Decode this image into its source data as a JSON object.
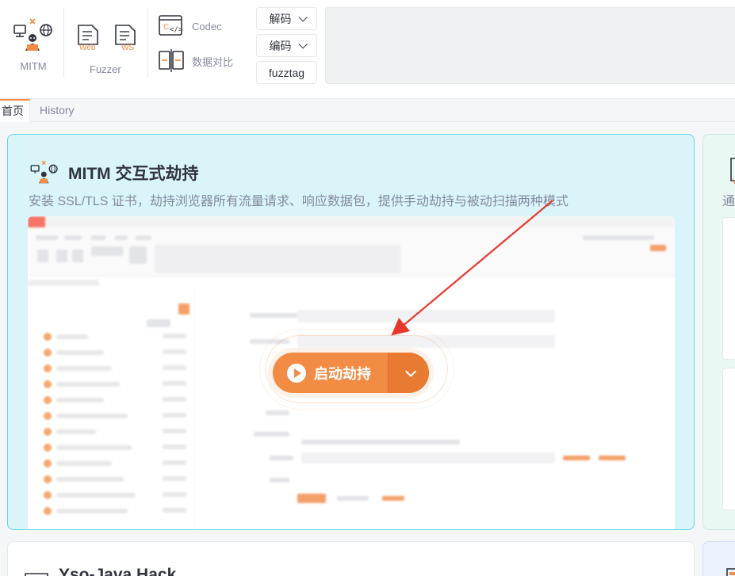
{
  "toolbar": {
    "mitm_label": "MITM",
    "fuzzer_label": "Fuzzer",
    "web_badge": "Web",
    "ws_badge": "WS",
    "codec_label": "Codec",
    "diff_label": "数据对比",
    "decode_label": "解码",
    "encode_label": "编码",
    "fuzztag_label": "fuzztag"
  },
  "tabs": [
    {
      "label": "首页",
      "active": true
    },
    {
      "label": "History",
      "active": false
    }
  ],
  "mitm_card": {
    "title": "MITM 交互式劫持",
    "description": "安装 SSL/TLS 证书，劫持浏览器所有流量请求、响应数据包，提供手动劫持与被动扫描两种模式",
    "start_button": "启动劫持"
  },
  "right_card": {
    "text_fragment": "通"
  },
  "bottom_card": {
    "title": "Yso-Java Hack"
  },
  "colors": {
    "accent": "#f28b44",
    "mitm_bg": "#d9f5f9",
    "mitm_border": "#62d7e6",
    "arrow": "#e8382b"
  },
  "icons": [
    "mitm-icon",
    "web-fuzzer-icon",
    "ws-fuzzer-icon",
    "codec-icon",
    "data-diff-icon",
    "chevron-down-icon",
    "play-icon"
  ]
}
